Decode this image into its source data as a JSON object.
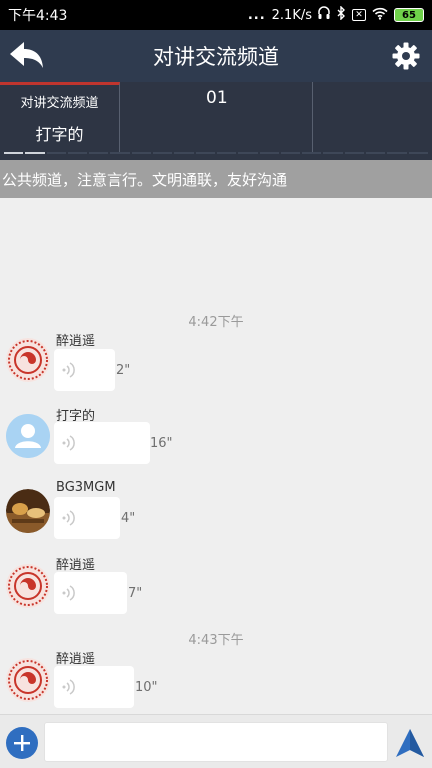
{
  "status_bar": {
    "time": "下午4:43",
    "dots": "...",
    "speed": "2.1K/s",
    "battery": "65"
  },
  "header": {
    "title": "对讲交流频道"
  },
  "channels": [
    {
      "name": "对讲交流频道",
      "user": "打字的"
    },
    {
      "number": "01"
    }
  ],
  "notice": "公共频道，注意言行。文明通联，友好沟通",
  "messages": [
    {
      "time": "4:42下午"
    },
    {
      "sender": "醉逍遥",
      "duration": "2\""
    },
    {
      "sender": "打字的",
      "duration": "16\""
    },
    {
      "sender": "BG3MGM",
      "duration": "4\""
    },
    {
      "sender": "醉逍遥",
      "duration": "7\""
    },
    {
      "time": "4:43下午"
    },
    {
      "sender": "醉逍遥",
      "duration": "10\""
    }
  ],
  "input": {
    "placeholder": ""
  },
  "colors": {
    "header": "#2f3b4f",
    "channel_bar": "#2e3544",
    "active_tab_line": "#c0352e",
    "notice_bg": "#a0a0a0",
    "accent": "#2f6ec0"
  }
}
